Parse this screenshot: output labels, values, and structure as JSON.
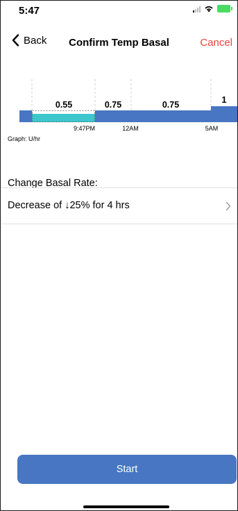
{
  "status_bar": {
    "time": "5:47",
    "icons": [
      "cellular-signal-icon",
      "wifi-icon",
      "battery-charging-icon"
    ]
  },
  "nav": {
    "back_label": "Back",
    "title": "Confirm Temp Basal",
    "cancel_label": "Cancel",
    "back_icon": "chevron-left-icon"
  },
  "colors": {
    "accent": "#4876c2",
    "temp_basal": "#3ec6cd",
    "cancel": "#e8443b"
  },
  "chart_data": {
    "type": "bar",
    "unit_label": "Graph: U/hr",
    "segments": [
      {
        "label": "",
        "value": 0.75,
        "kind": "current"
      },
      {
        "label": "0.55",
        "value": 0.55,
        "kind": "temp",
        "scheduled": 0.75
      },
      {
        "label": "0.75",
        "value": 0.75,
        "kind": "scheduled"
      },
      {
        "label": "0.75",
        "value": 0.75,
        "kind": "scheduled"
      },
      {
        "label": "1",
        "value": 1,
        "kind": "scheduled"
      }
    ],
    "time_labels": [
      "9:47PM",
      "12AM",
      "5AM"
    ]
  },
  "form": {
    "section_label": "Change Basal Rate:",
    "rate_value": "Decrease of ↓25% for 4 hrs",
    "row_icon": "chevron-right-icon"
  },
  "actions": {
    "start_label": "Start"
  }
}
